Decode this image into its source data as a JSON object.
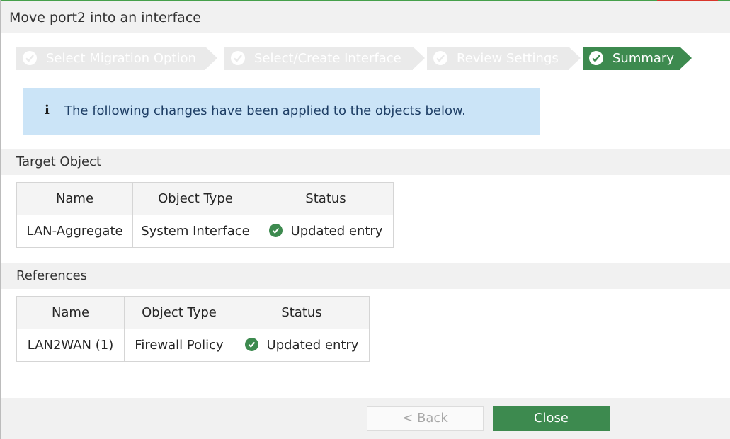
{
  "dialog": {
    "title": "Move port2 into an interface"
  },
  "wizard": {
    "steps": [
      {
        "label": "Select Migration Option",
        "state": "done"
      },
      {
        "label": "Select/Create Interface",
        "state": "done"
      },
      {
        "label": "Review Settings",
        "state": "done"
      },
      {
        "label": "Summary",
        "state": "active"
      }
    ]
  },
  "info": {
    "icon": "info-icon",
    "message": "The following changes have been applied to the objects below."
  },
  "target": {
    "heading": "Target Object",
    "columns": [
      "Name",
      "Object Type",
      "Status"
    ],
    "rows": [
      {
        "name": "LAN-Aggregate",
        "type": "System Interface",
        "status": "Updated entry",
        "status_icon": "check-circle-icon"
      }
    ]
  },
  "references": {
    "heading": "References",
    "columns": [
      "Name",
      "Object Type",
      "Status"
    ],
    "rows": [
      {
        "name": "LAN2WAN (1)",
        "type": "Firewall Policy",
        "status": "Updated entry",
        "status_icon": "check-circle-icon"
      }
    ]
  },
  "buttons": {
    "back": "< Back",
    "close": "Close"
  },
  "colors": {
    "accent": "#3d8a4f",
    "info_bg": "#cbe4f7",
    "step_done_bg": "#eaeaea"
  }
}
